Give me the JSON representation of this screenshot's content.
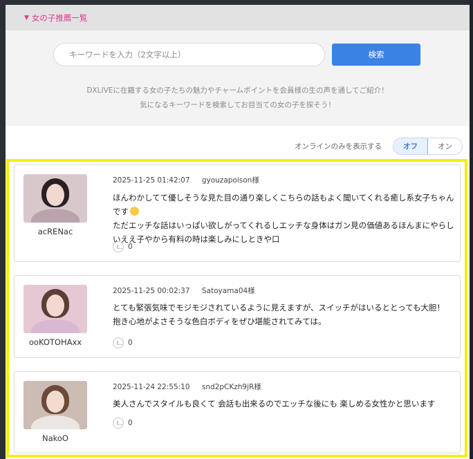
{
  "header": {
    "title": "女の子推薦一覧"
  },
  "search": {
    "placeholder": "キーワードを入力（2文字以上）",
    "button_label": "検索"
  },
  "intro": {
    "line1": "DXLIVEに在籍する女の子たちの魅力やチャームポイントを会員様の生の声を通してご紹介！",
    "line2": "気になるキーワードを検索してお目当ての女の子を探そう！"
  },
  "filter": {
    "label": "オンラインのみを表示する",
    "off_label": "オフ",
    "on_label": "オン",
    "selected": "オフ"
  },
  "posts": [
    {
      "username": "acRENac",
      "date": "2025-11-25 01:42:07",
      "author": "gyouzapoison様",
      "comment": "ほんわかしてて優しそうな見た目の通り楽しくこちらの話もよく聞いてくれる癒し系女子ちゃんです",
      "comment_cont": "ただエッチな話はいっぱい欲しがってくれるしエッチな身体はガン見の価値あるほんまにやらしいええ子やから有料の時は楽しみにしときや口",
      "likes": "0",
      "avatar_colors": {
        "bg": "#d8c8cc",
        "hair": "#2a1f25",
        "face": "#f1d9d0",
        "body": "#b9a3ad"
      }
    },
    {
      "username": "ooKOTOHAxx",
      "date": "2025-11-25 00:02:37",
      "author": "Satoyama04様",
      "comment": "とても緊張気味でモジモジされているように見えますが、スイッチがはいるととっても大胆！ 抱き心地がよさそうな色白ボディをぜひ堪能されてみては。",
      "likes": "0",
      "avatar_colors": {
        "bg": "#e4c9d4",
        "hair": "#5a3e37",
        "face": "#f3d8cf",
        "body": "#d8b9d1"
      }
    },
    {
      "username": "NakoO",
      "date": "2025-11-24 22:55:10",
      "author": "snd2pCKzh9jR様",
      "comment": "美人さんでスタイルも良くて 会話も出来るのでエッチな後にも 楽しめる女性かと思います",
      "likes": "0",
      "avatar_colors": {
        "bg": "#cdbcb4",
        "hair": "#6b4a3a",
        "face": "#f2dccf",
        "body": "#ece6e2"
      }
    }
  ]
}
